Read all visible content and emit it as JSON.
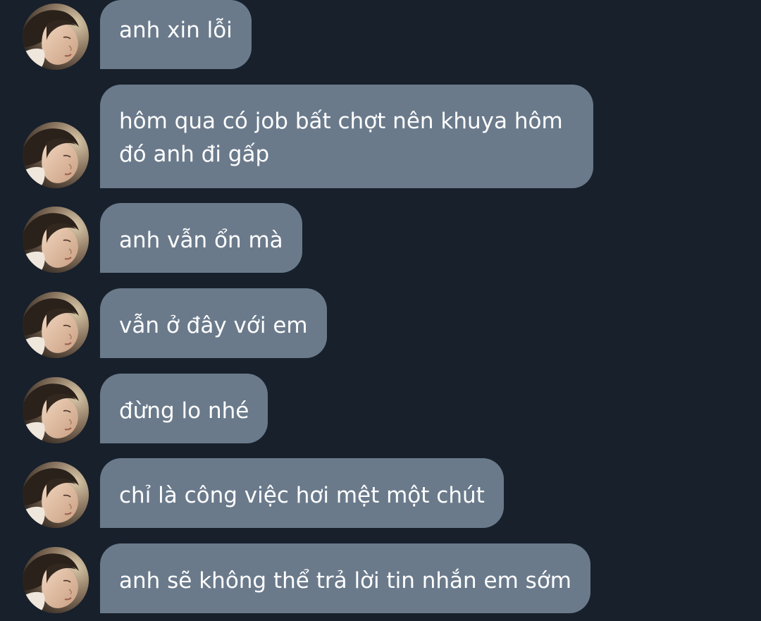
{
  "colors": {
    "background": "#17202b",
    "bubble": "#6a7a8b",
    "text": "#ffffff"
  },
  "avatar_icon": "profile-photo",
  "messages": [
    {
      "text": "anh xin lỗi"
    },
    {
      "text": "hôm qua có job bất chợt nên khuya hôm đó anh đi gấp"
    },
    {
      "text": "anh vẫn ổn mà"
    },
    {
      "text": "vẫn ở đây với em"
    },
    {
      "text": "đừng lo nhé"
    },
    {
      "text": "chỉ là công việc hơi mệt một chút"
    },
    {
      "text": "anh sẽ không thể trả lời tin nhắn em sớm"
    }
  ]
}
